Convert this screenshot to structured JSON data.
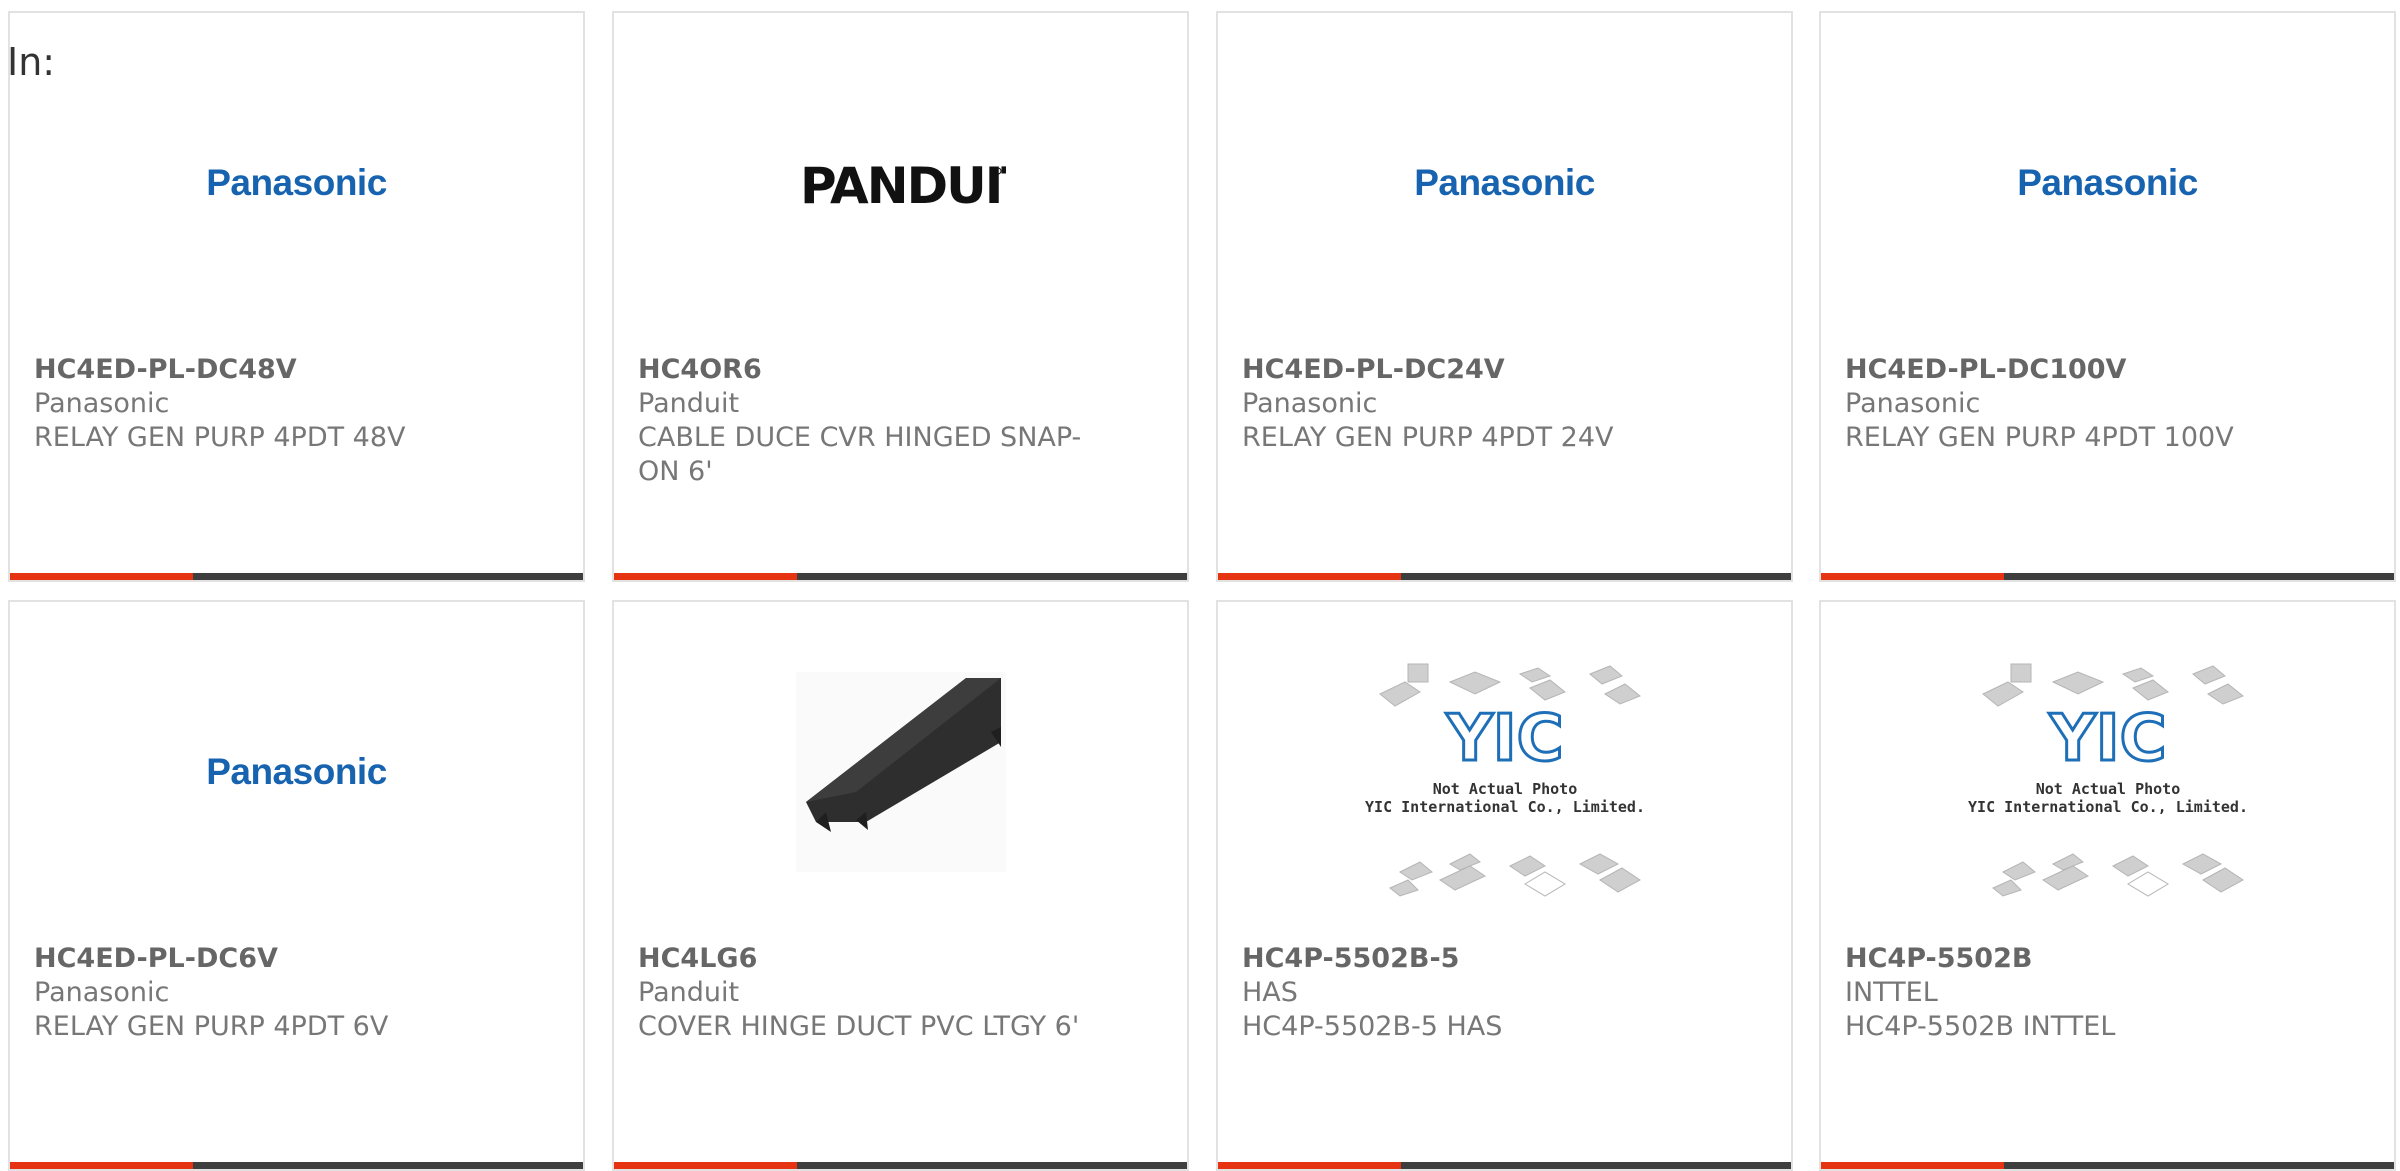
{
  "filter_label": "In:",
  "colors": {
    "accent": "#e63312",
    "bar": "#3e3e3e",
    "panasonic_blue": "#1763b0"
  },
  "products": [
    {
      "part_number": "HC4ED-PL-DC48V",
      "manufacturer": "Panasonic",
      "description": "RELAY GEN PURP 4PDT 48V",
      "image": "panasonic-logo",
      "logo_text": "Panasonic"
    },
    {
      "part_number": "HC4OR6",
      "manufacturer": "Panduit",
      "description_line1": "CABLE DUCE CVR HINGED SNAP-",
      "description_line2": "ON 6'",
      "image": "panduit-logo",
      "logo_text": "PANDUIT"
    },
    {
      "part_number": "HC4ED-PL-DC24V",
      "manufacturer": "Panasonic",
      "description": "RELAY GEN PURP 4PDT 24V",
      "image": "panasonic-logo",
      "logo_text": "Panasonic"
    },
    {
      "part_number": "HC4ED-PL-DC100V",
      "manufacturer": "Panasonic",
      "description": "RELAY GEN PURP 4PDT 100V",
      "image": "panasonic-logo",
      "logo_text": "Panasonic"
    },
    {
      "part_number": "HC4ED-PL-DC6V",
      "manufacturer": "Panasonic",
      "description": "RELAY GEN PURP 4PDT 6V",
      "image": "panasonic-logo",
      "logo_text": "Panasonic"
    },
    {
      "part_number": "HC4LG6",
      "manufacturer": "Panduit",
      "description": "COVER HINGE DUCT PVC LTGY 6'",
      "image": "duct-cover-photo"
    },
    {
      "part_number": "HC4P-5502B-5",
      "manufacturer": "HAS",
      "description": "HC4P-5502B-5 HAS",
      "image": "placeholder-photo",
      "placeholder_line1": "Not Actual Photo",
      "placeholder_line2": "YIC International Co., Limited.",
      "placeholder_logo": "YIC"
    },
    {
      "part_number": "HC4P-5502B",
      "manufacturer": "INTTEL",
      "description": "HC4P-5502B INTTEL",
      "image": "placeholder-photo",
      "placeholder_line1": "Not Actual Photo",
      "placeholder_line2": "YIC International Co., Limited.",
      "placeholder_logo": "YIC"
    }
  ]
}
